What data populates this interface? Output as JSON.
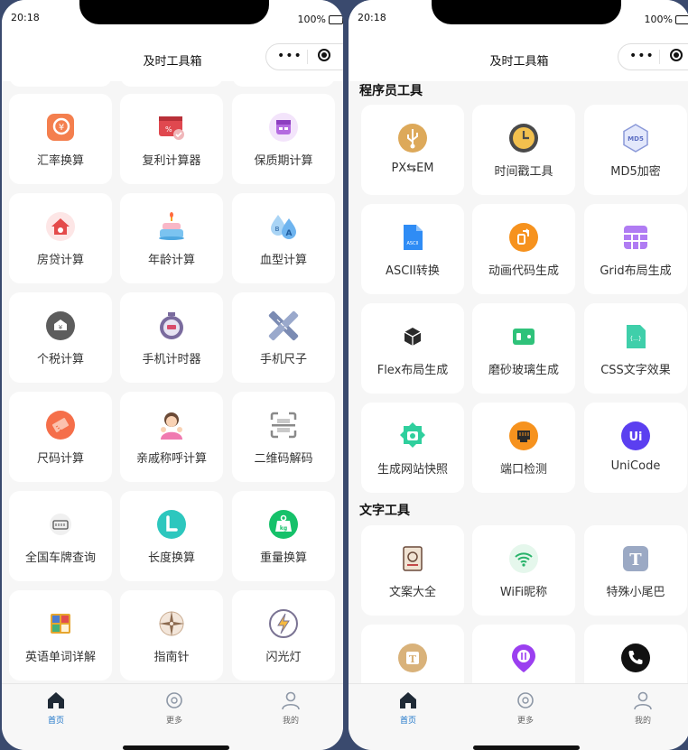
{
  "status": {
    "time": "20:18",
    "battery": "100%"
  },
  "navbar": {
    "title": "及时工具箱",
    "menu_dots": "•••"
  },
  "left_tools": [
    {
      "label": "汇率换算",
      "icon": "exchange-rate-icon"
    },
    {
      "label": "复利计算器",
      "icon": "compound-interest-icon"
    },
    {
      "label": "保质期计算",
      "icon": "shelf-life-icon"
    },
    {
      "label": "房贷计算",
      "icon": "mortgage-icon"
    },
    {
      "label": "年龄计算",
      "icon": "birthday-cake-icon"
    },
    {
      "label": "血型计算",
      "icon": "blood-type-icon"
    },
    {
      "label": "个税计算",
      "icon": "income-tax-icon"
    },
    {
      "label": "手机计时器",
      "icon": "stopwatch-icon"
    },
    {
      "label": "手机尺子",
      "icon": "ruler-icon"
    },
    {
      "label": "尺码计算",
      "icon": "size-tag-icon"
    },
    {
      "label": "亲戚称呼计算",
      "icon": "relatives-icon"
    },
    {
      "label": "二维码解码",
      "icon": "qr-scan-icon"
    },
    {
      "label": "全国车牌查询",
      "icon": "license-plate-icon"
    },
    {
      "label": "长度换算",
      "icon": "length-icon"
    },
    {
      "label": "重量换算",
      "icon": "weight-icon"
    },
    {
      "label": "英语单词详解",
      "icon": "dictionary-icon"
    },
    {
      "label": "指南针",
      "icon": "compass-icon"
    },
    {
      "label": "闪光灯",
      "icon": "flashlight-icon"
    }
  ],
  "right": {
    "section_programmer": "程序员工具",
    "section_text": "文字工具",
    "programmer_tools": [
      {
        "label": "PX⇆EM",
        "icon": "px-em-icon"
      },
      {
        "label": "时间戳工具",
        "icon": "timestamp-clock-icon"
      },
      {
        "label": "MD5加密",
        "icon": "md5-icon",
        "badge": "MD5"
      },
      {
        "label": "ASCII转换",
        "icon": "ascii-file-icon",
        "badge": "ASCII"
      },
      {
        "label": "动画代码生成",
        "icon": "animation-code-icon"
      },
      {
        "label": "Grid布局生成",
        "icon": "grid-layout-icon"
      },
      {
        "label": "Flex布局生成",
        "icon": "flex-box-icon"
      },
      {
        "label": "磨砂玻璃生成",
        "icon": "frosted-glass-icon"
      },
      {
        "label": "CSS文字效果",
        "icon": "css-file-icon",
        "badge": "{...}"
      },
      {
        "label": "生成网站快照",
        "icon": "site-snapshot-icon"
      },
      {
        "label": "端口检测",
        "icon": "port-check-icon"
      },
      {
        "label": "UniCode",
        "icon": "unicode-icon",
        "badge": "Ui"
      }
    ],
    "text_tools": [
      {
        "label": "文案大全",
        "icon": "copywriting-icon"
      },
      {
        "label": "WiFi昵称",
        "icon": "wifi-icon"
      },
      {
        "label": "特殊小尾巴",
        "icon": "special-tail-icon",
        "badge": "T"
      },
      {
        "label": "",
        "icon": "text-style-icon",
        "badge": "T"
      },
      {
        "label": "",
        "icon": "location-pin-icon"
      },
      {
        "label": "",
        "icon": "phone-icon"
      }
    ]
  },
  "tabbar": {
    "items": [
      {
        "label": "首页",
        "icon": "home-icon",
        "active": true
      },
      {
        "label": "更多",
        "icon": "more-icon",
        "active": false
      },
      {
        "label": "我的",
        "icon": "profile-icon",
        "active": false
      }
    ]
  },
  "colors": {
    "accent": "#1a73c8",
    "background": "#f6f6f6",
    "card": "#ffffff"
  }
}
